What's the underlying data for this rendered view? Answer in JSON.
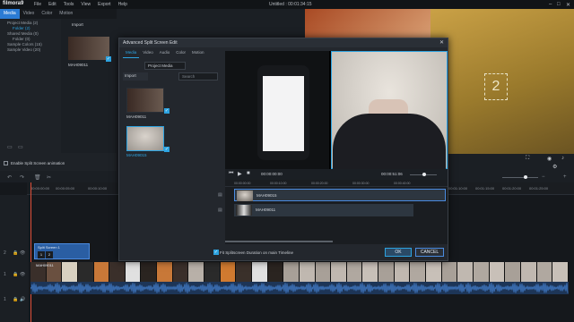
{
  "app": {
    "name": "filmora9",
    "menu": [
      "File",
      "Edit",
      "Tools",
      "View",
      "Export",
      "Help"
    ],
    "window_title": "Untitled : 00:01:34:15"
  },
  "library": {
    "tabs": [
      "Media",
      "Video",
      "Color",
      "Motion"
    ],
    "import_label": "Import",
    "search_placeholder": "Search",
    "folders": [
      "Project Media (2)",
      "Folder (2)",
      "Shared Media (0)",
      "Folder (0)",
      "Sample Colors (15)",
      "Sample Video (20)"
    ],
    "clip_name": "MAH09011",
    "split_screen_animation": "Enable Split Screen animation"
  },
  "dialog": {
    "title": "Advanced Split Screen Edit",
    "tabs": [
      "Media",
      "Video",
      "Audio",
      "Color",
      "Motion"
    ],
    "project_media": "Project Media",
    "import_label": "Import",
    "search_placeholder": "Search",
    "clips": [
      "MAH09011",
      "MAH09015"
    ],
    "time_left": "00:00:00:00",
    "time_right": "00:00:51:06",
    "ruler": [
      "00:00:00:00",
      "00:00:10:00",
      "00:00:20:00",
      "00:00:30:00",
      "00:00:40:00"
    ],
    "tracks": [
      "MAH09015",
      "MAH09011"
    ],
    "fit_label": "Fit Splitscreen Duration on main Timeline",
    "ok": "OK",
    "cancel": "CANCEL"
  },
  "timeline": {
    "ruler": [
      "00:00:00:00",
      "00:00:05:00",
      "00:00:10:00",
      "00:01:10:00",
      "00:01:15:00",
      "00:01:20:00",
      "00:01:25:00"
    ],
    "split_clip_label": "Split Screen 1",
    "video_clip_label": "MAH09011",
    "track_labels": [
      "2",
      "1",
      "1"
    ]
  },
  "preview": {
    "overlay_number": "2"
  }
}
